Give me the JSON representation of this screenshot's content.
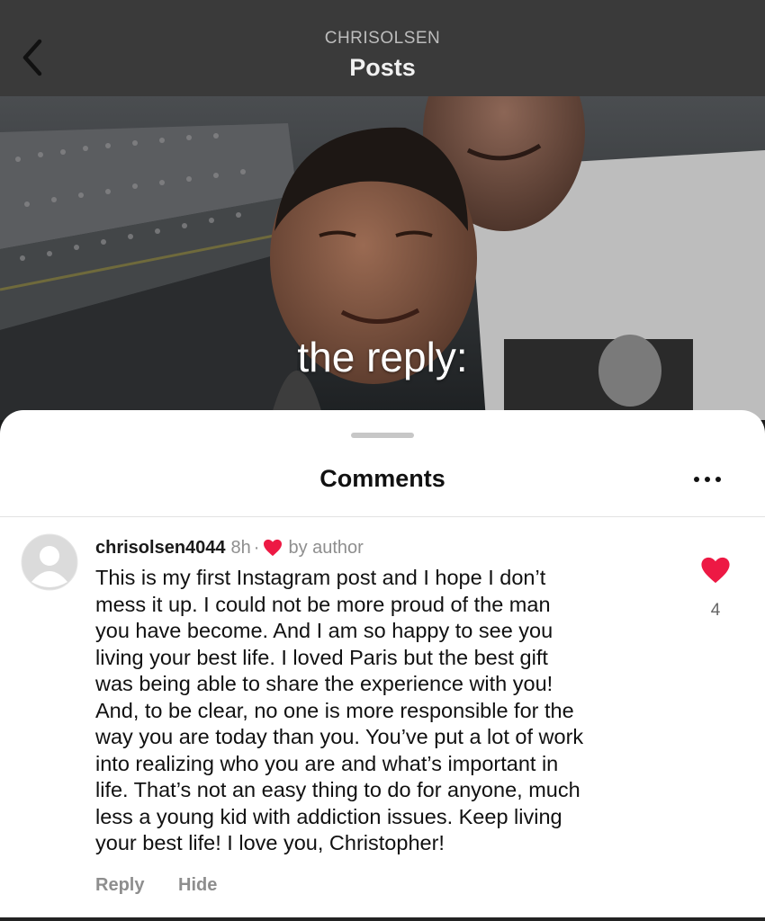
{
  "header": {
    "account": "CHRISOLSEN",
    "title": "Posts"
  },
  "post": {
    "overlay_text": "the reply:"
  },
  "comments": {
    "title": "Comments",
    "items": [
      {
        "username": "chrisolsen4044",
        "time": "8h",
        "separator": "·",
        "liked_by_author": "by author",
        "text_lines": [
          "This is my first Instagram post  and I hope I don’t",
          "mess it up.  I could not be more proud of the man",
          "you have become.  And I am so happy to see you",
          "living your best life. I loved Paris but the best gift",
          "was being able to share the experience with you!",
          "And, to be clear, no one is more responsible for the",
          "way you are today than you. You’ve put a lot of work",
          "into realizing who you are and what’s important in",
          "life.  That’s not an easy thing to do for anyone, much",
          "less a young kid with addiction issues.  Keep living",
          "your best life!  I love you, Christopher!"
        ],
        "like_count": "4",
        "reply_label": "Reply",
        "hide_label": "Hide"
      }
    ]
  },
  "colors": {
    "heart": "#ed1944",
    "header_bg": "#3a3a3a",
    "sheet_bg": "#ffffff"
  }
}
